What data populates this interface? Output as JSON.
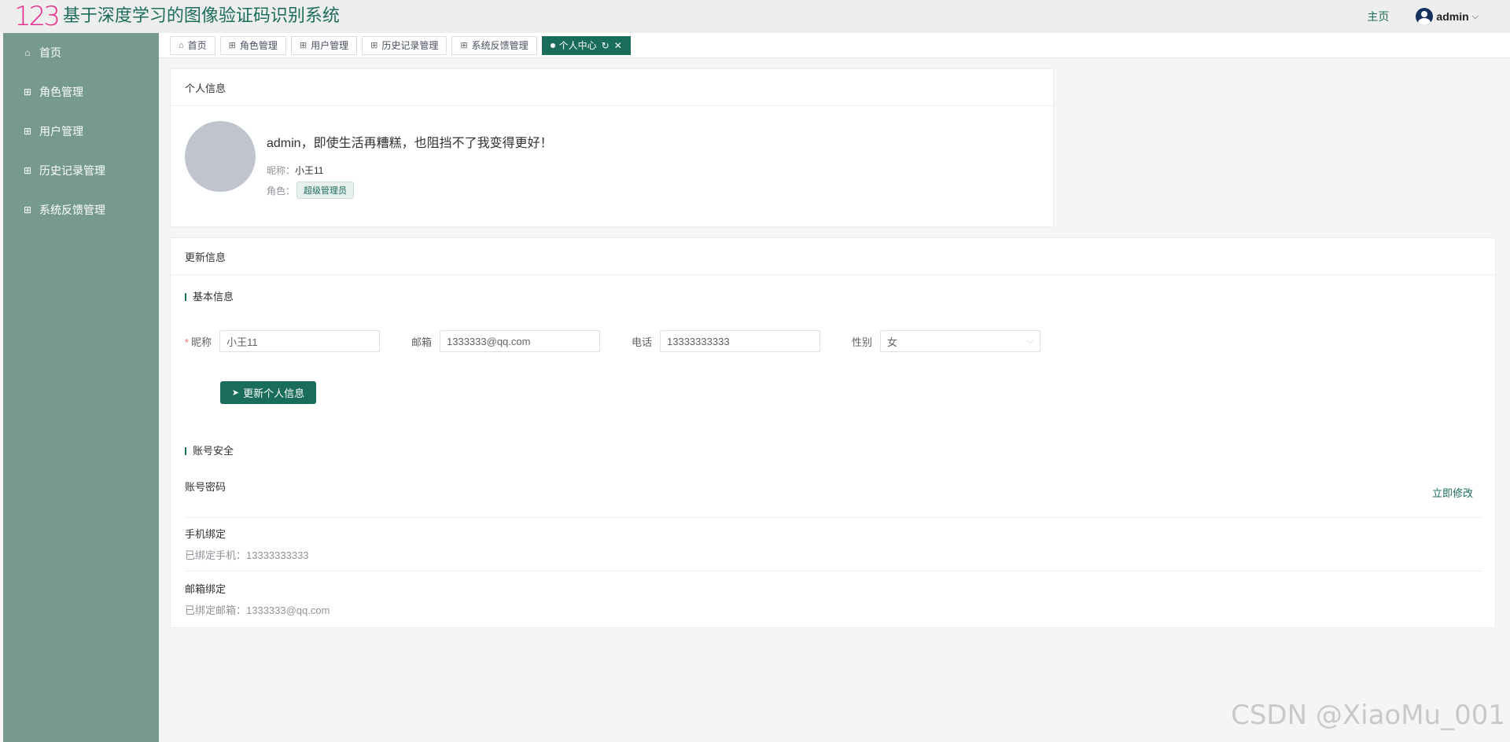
{
  "header": {
    "logo": "123",
    "title": "基于深度学习的图像验证码识别系统",
    "home_link": "主页",
    "username": "admin",
    "caret": "⌵"
  },
  "sidebar": {
    "items": [
      {
        "label": "首页",
        "icon": "home-icon"
      },
      {
        "label": "角色管理",
        "icon": "grid-icon"
      },
      {
        "label": "用户管理",
        "icon": "grid-icon"
      },
      {
        "label": "历史记录管理",
        "icon": "grid-icon"
      },
      {
        "label": "系统反馈管理",
        "icon": "grid-icon"
      }
    ]
  },
  "tabs": [
    {
      "label": "首页",
      "icon": "home-icon"
    },
    {
      "label": "角色管理",
      "icon": "grid-icon"
    },
    {
      "label": "用户管理",
      "icon": "grid-icon"
    },
    {
      "label": "历史记录管理",
      "icon": "grid-icon"
    },
    {
      "label": "系统反馈管理",
      "icon": "grid-icon"
    },
    {
      "label": "个人中心",
      "icon": "dot-icon",
      "active": true
    }
  ],
  "profile_card": {
    "title": "个人信息",
    "greeting": "admin，即使生活再糟糕，也阻挡不了我变得更好！",
    "nickname_label": "昵称：",
    "nickname": "小王11",
    "role_label": "角色：",
    "role": "超级管理员"
  },
  "update_card": {
    "title": "更新信息",
    "basic_section": "基本信息",
    "fields": {
      "nickname": {
        "label": "昵称",
        "value": "小王11"
      },
      "email": {
        "label": "邮箱",
        "value": "1333333@qq.com"
      },
      "phone": {
        "label": "电话",
        "value": "13333333333"
      },
      "gender": {
        "label": "性别",
        "value": "女"
      }
    },
    "update_button": "更新个人信息",
    "security_section": "账号安全",
    "password": {
      "title": "账号密码",
      "action": "立即修改"
    },
    "phone_bind": {
      "title": "手机绑定",
      "desc": "已绑定手机：13333333333"
    },
    "email_bind": {
      "title": "邮箱绑定",
      "desc": "已绑定邮箱：1333333@qq.com"
    }
  },
  "watermark": "CSDN @XiaoMu_001",
  "colors": {
    "primary": "#1a6d5a",
    "sidebar": "#769a8f",
    "logo": "#e6288a"
  }
}
